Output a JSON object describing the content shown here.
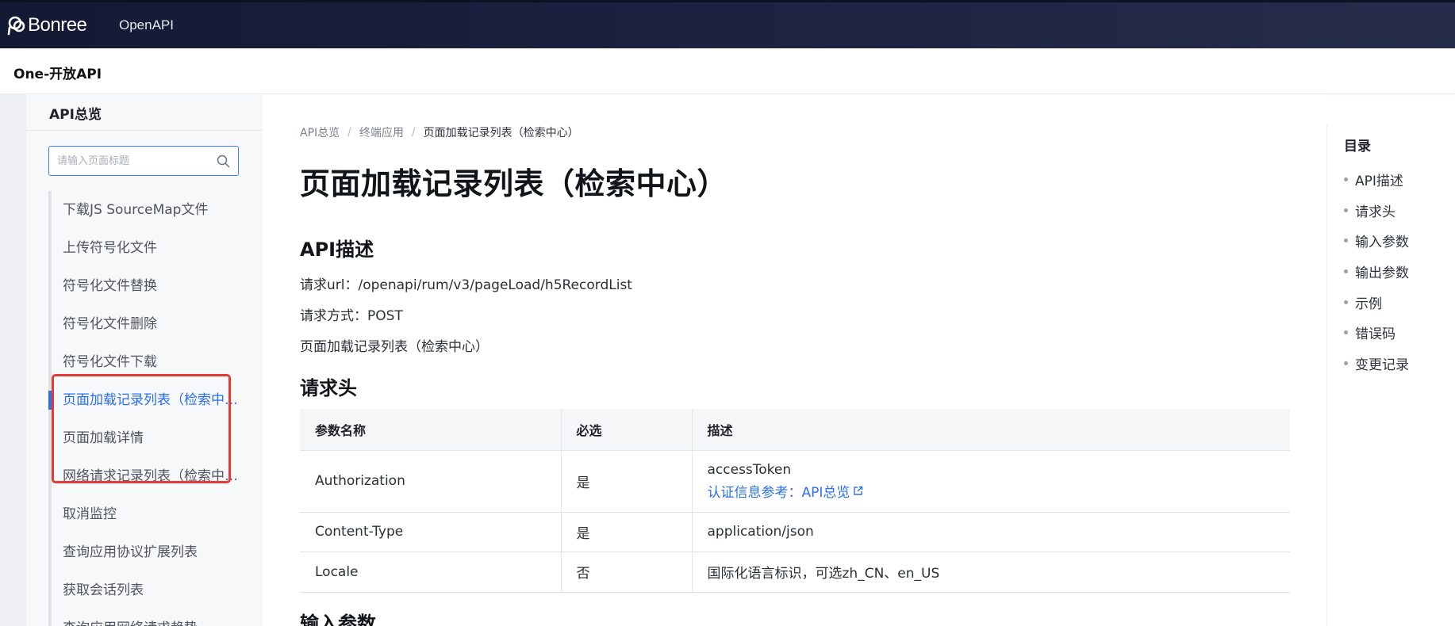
{
  "topbar": {
    "brand": "Bonree",
    "nav_item": "OpenAPI"
  },
  "subheader": {
    "title": "One-开放API"
  },
  "sidebar": {
    "title": "API总览",
    "search_placeholder": "请输入页面标题",
    "items": [
      {
        "label": "下载JS SourceMap文件",
        "active": false
      },
      {
        "label": "上传符号化文件",
        "active": false
      },
      {
        "label": "符号化文件替换",
        "active": false
      },
      {
        "label": "符号化文件删除",
        "active": false
      },
      {
        "label": "符号化文件下载",
        "active": false
      },
      {
        "label": "页面加载记录列表（检索中心）",
        "active": true
      },
      {
        "label": "页面加载详情",
        "active": false
      },
      {
        "label": "网络请求记录列表（检索中心）",
        "active": false
      },
      {
        "label": "取消监控",
        "active": false
      },
      {
        "label": "查询应用协议扩展列表",
        "active": false
      },
      {
        "label": "获取会话列表",
        "active": false
      },
      {
        "label": "查询应用网络请求趋势",
        "active": false
      }
    ]
  },
  "main": {
    "breadcrumb": [
      "API总览",
      "终端应用",
      "页面加载记录列表（检索中心）"
    ],
    "page_title": "页面加载记录列表（检索中心）",
    "section_api_desc": "API描述",
    "request_url": "请求url：/openapi/rum/v3/pageLoad/h5RecordList",
    "request_method": "请求方式：POST",
    "description": "页面加载记录列表（检索中心）",
    "section_headers": "请求头",
    "table": {
      "columns": [
        "参数名称",
        "必选",
        "描述"
      ],
      "rows": [
        {
          "name": "Authorization",
          "required": "是",
          "desc": "accessToken",
          "link": "认证信息参考：API总览"
        },
        {
          "name": "Content-Type",
          "required": "是",
          "desc": "application/json"
        },
        {
          "name": "Locale",
          "required": "否",
          "desc": "国际化语言标识，可选zh_CN、en_US"
        }
      ]
    },
    "section_input": "输入参数"
  },
  "toc": {
    "title": "目录",
    "items": [
      "API描述",
      "请求头",
      "输入参数",
      "输出参数",
      "示例",
      "错误码",
      "变更记录"
    ]
  },
  "colors": {
    "topbar": "#1c2240",
    "accent": "#2a6ff0",
    "highlight": "#e53935"
  }
}
